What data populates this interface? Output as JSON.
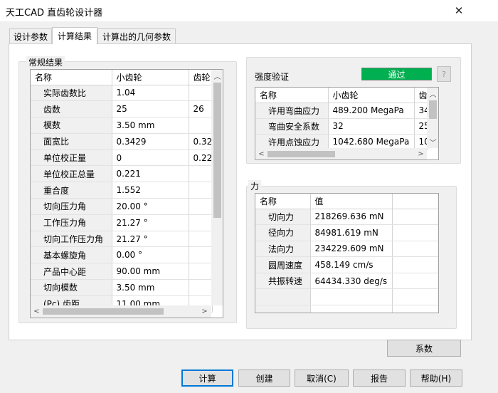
{
  "window": {
    "title": "天工CAD 直齿轮设计器"
  },
  "tabs": [
    {
      "label": "设计参数",
      "active": false
    },
    {
      "label": "计算结果",
      "active": true
    },
    {
      "label": "计算出的几何参数",
      "active": false
    }
  ],
  "general_results": {
    "legend": "常规结果",
    "columns": [
      "名称",
      "小齿轮",
      "齿轮"
    ],
    "rows": [
      [
        "实际齿数比",
        "1.04",
        ""
      ],
      [
        "齿数",
        "25",
        "26"
      ],
      [
        "模数",
        "3.50 mm",
        ""
      ],
      [
        "面宽比",
        "0.3429",
        "0.32"
      ],
      [
        "单位校正量",
        "0",
        "0.22"
      ],
      [
        "单位校正总量",
        "0.221",
        ""
      ],
      [
        "重合度",
        "1.552",
        ""
      ],
      [
        "切向压力角",
        "20.00 °",
        ""
      ],
      [
        "工作压力角",
        "21.27 °",
        ""
      ],
      [
        "切向工作压力角",
        "21.27 °",
        ""
      ],
      [
        "基本螺旋角",
        "0.00 °",
        ""
      ],
      [
        "产品中心距",
        "90.00 mm",
        ""
      ],
      [
        "切向模数",
        "3.50 mm",
        ""
      ],
      [
        "(Pc) 齿距",
        "11.00 mm",
        ""
      ]
    ]
  },
  "strength": {
    "label": "强度验证",
    "status": "通过",
    "status_color": "#00b050",
    "help_icon": "?",
    "columns": [
      "名称",
      "小齿轮",
      "齿轮"
    ],
    "rows": [
      [
        "许用弯曲应力",
        "489.200 MegaPa",
        "34"
      ],
      [
        "弯曲安全系数",
        "32",
        "25"
      ],
      [
        "许用点蚀应力",
        "1042.680 MegaPa",
        "10"
      ]
    ]
  },
  "forces": {
    "legend": "力",
    "columns": [
      "名称",
      "值",
      ""
    ],
    "rows": [
      [
        "切向力",
        "218269.636 mN"
      ],
      [
        "径向力",
        "84981.619 mN"
      ],
      [
        "法向力",
        "234229.609 mN"
      ],
      [
        "圆周速度",
        "458.149 cm/s"
      ],
      [
        "共振转速",
        "64434.330 deg/s"
      ],
      [
        "",
        ""
      ],
      [
        "",
        ""
      ]
    ]
  },
  "buttons": {
    "coefficients": "系数",
    "calculate": "计算",
    "create": "创建",
    "cancel": "取消(C)",
    "report": "报告",
    "help": "帮助(H)"
  }
}
